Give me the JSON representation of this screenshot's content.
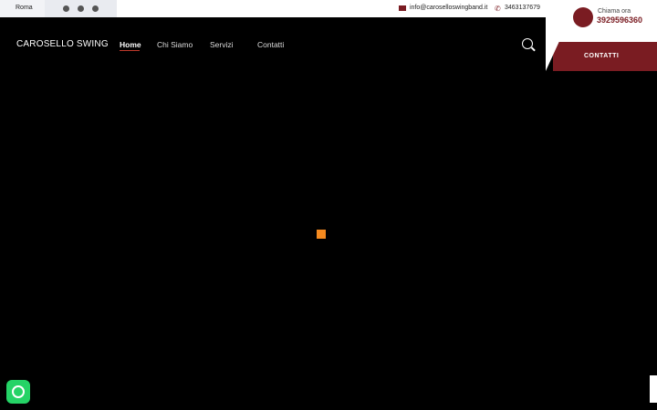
{
  "topbar": {
    "location": "Roma",
    "social_icons": [
      "facebook-icon",
      "instagram-icon",
      "youtube-icon"
    ],
    "email": "info@caroselloswingband.it",
    "phone": "3463137679"
  },
  "call": {
    "label": "Chiama ora",
    "number": "3929596360"
  },
  "header": {
    "logo": "CAROSELLO SWING",
    "nav": [
      {
        "label": "Home",
        "active": true
      },
      {
        "label": "Chi Siamo",
        "active": false
      },
      {
        "label": "Servizi",
        "active": false
      },
      {
        "label": "Contatti",
        "active": false
      }
    ],
    "contact_button": "CONTATTI"
  },
  "colors": {
    "brand": "#7a1c22",
    "loader": "#f58a1f",
    "whatsapp": "#25d366"
  }
}
